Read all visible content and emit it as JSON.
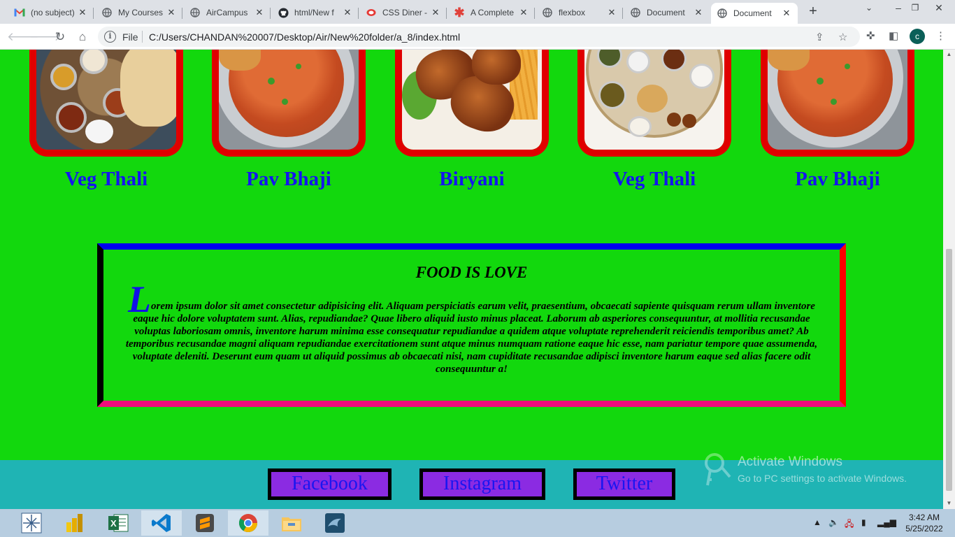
{
  "browser": {
    "tabs": [
      {
        "title": "(no subject)",
        "icon": "gmail-icon"
      },
      {
        "title": "My Courses",
        "icon": "globe-icon"
      },
      {
        "title": "AirCampus",
        "icon": "globe-icon"
      },
      {
        "title": "html/New f",
        "icon": "github-icon"
      },
      {
        "title": "CSS Diner -",
        "icon": "cssdiner-icon"
      },
      {
        "title": "A Complete",
        "icon": "asterisk-icon"
      },
      {
        "title": "flexbox",
        "icon": "globe-icon"
      },
      {
        "title": "Document",
        "icon": "globe-icon"
      },
      {
        "title": "Document",
        "icon": "globe-icon",
        "active": true
      }
    ],
    "address": {
      "scheme_label": "File",
      "url": "C:/Users/CHANDAN%20007/Desktop/Air/New%20folder/a_8/index.html"
    },
    "profile_initial": "c"
  },
  "page": {
    "foods": [
      {
        "name": "Veg Thali"
      },
      {
        "name": "Pav Bhaji"
      },
      {
        "name": "Biryani"
      },
      {
        "name": "Veg Thali"
      },
      {
        "name": "Pav Bhaji"
      }
    ],
    "love": {
      "title": "FOOD IS LOVE",
      "dropcap": "L",
      "body": "orem ipsum dolor sit amet consectetur adipisicing elit. Aliquam perspiciatis earum velit, praesentium, obcaecati sapiente quisquam rerum ullam inventore eaque hic dolore voluptatem sunt. Alias, repudiandae? Quae libero aliquid iusto minus placeat. Laborum ab asperiores consequuntur, at mollitia recusandae voluptas laboriosam omnis, inventore harum minima esse consequatur repudiandae a quidem atque voluptate reprehenderit reiciendis temporibus amet? Ab temporibus recusandae magni aliquam repudiandae exercitationem sunt atque minus numquam ratione eaque hic esse, nam pariatur tempore quae assumenda, voluptate deleniti. Deserunt eum quam ut aliquid possimus ab obcaecati nisi, nam cupiditate recusandae adipisci inventore harum eaque sed alias facere odit consequuntur a!"
    },
    "social": [
      {
        "label": "Facebook"
      },
      {
        "label": "Instagram"
      },
      {
        "label": "Twitter"
      }
    ],
    "colors": {
      "page_bg": "#12d80d",
      "footer_bg": "#1fb4b4",
      "food_name": "#1414f0",
      "card_border": "#e00000",
      "social_bg": "#8b2be2"
    }
  },
  "watermark": {
    "line1": "Activate Windows",
    "line2": "Go to PC settings to activate Windows."
  },
  "taskbar": {
    "apps": [
      "network-icon",
      "powerbi-icon",
      "excel-icon",
      "vscode-icon",
      "sublime-icon",
      "chrome-icon",
      "file-explorer-icon",
      "mysql-icon"
    ],
    "time": "3:42 AM",
    "date": "5/25/2022"
  }
}
